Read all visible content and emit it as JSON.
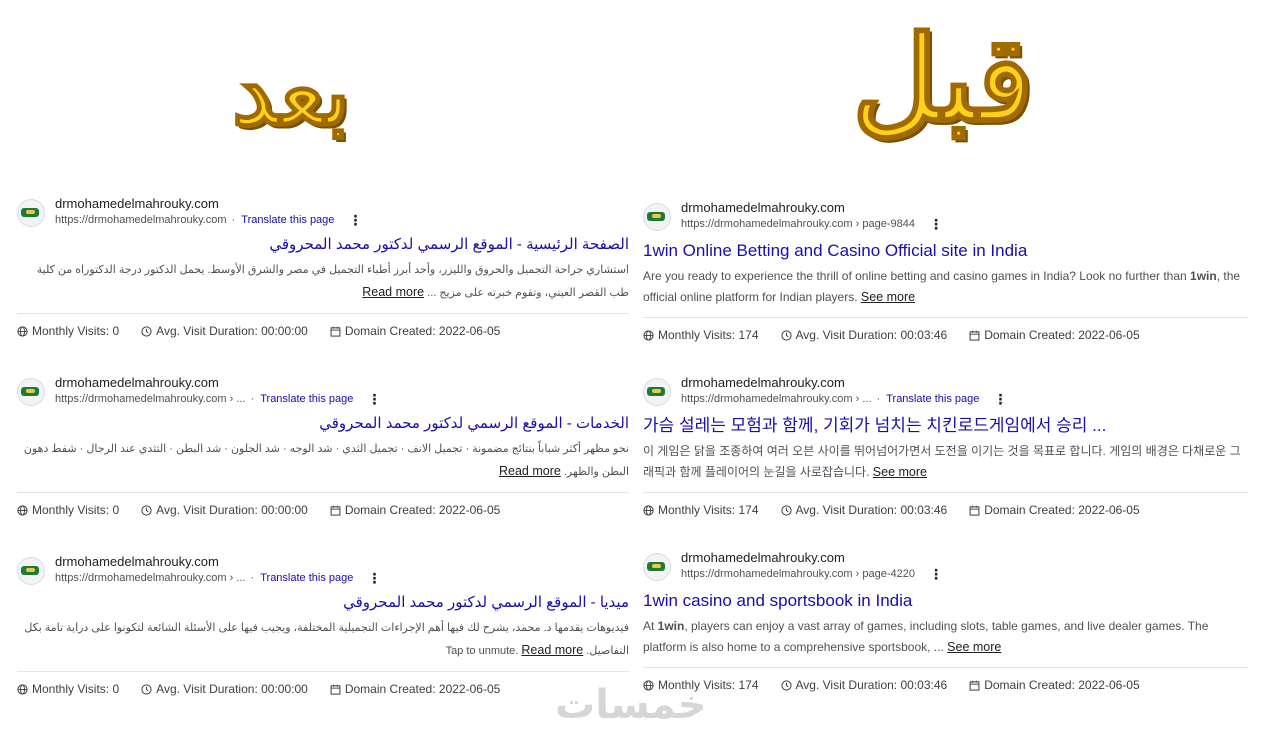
{
  "headings": {
    "after": "بعد",
    "before": "قبل"
  },
  "stat_labels": {
    "visits": "Monthly Visits:",
    "duration": "Avg. Visit Duration:",
    "created": "Domain Created:"
  },
  "more_labels": {
    "read": "Read more",
    "see": "See more"
  },
  "left_results": [
    {
      "site": "drmohamedelmahrouky.com",
      "url": "https://drmohamedelmahrouky.com",
      "translate": "Translate this page",
      "title": "الصفحة الرئيسية - الموقع الرسمي لدكتور محمد المحروقي",
      "snippet": "استشاري جراحة التجميل والحروق والليزر، وأحد أبرز أطباء التجميل في مصر والشرق الأوسط. يحمل الدكتور درجة الدكتوراه من كلية طب القصر العيني، وتقوم خبرته على مزيج ...",
      "visits": "0",
      "duration": "00:00:00",
      "created": "2022-06-05"
    },
    {
      "site": "drmohamedelmahrouky.com",
      "url": "https://drmohamedelmahrouky.com › ...",
      "translate": "Translate this page",
      "title": "الخدمات - الموقع الرسمي لدكتور محمد المحروقي",
      "snippet": "نحو مظهر أكثر شباباً بنتائج مضمونة · تجميل الانف · تجميل الثدي · شد الوجه · شد الجلون · شد البطن · التثدي عند الرجال · شفط دهون البطن والظهر.",
      "visits": "0",
      "duration": "00:00:00",
      "created": "2022-06-05"
    },
    {
      "site": "drmohamedelmahrouky.com",
      "url": "https://drmohamedelmahrouky.com › ...",
      "translate": "Translate this page",
      "title": "ميديا - الموقع الرسمي لدكتور محمد المحروقي",
      "snippet": "فيديوهات يقدمها د. محمد، يشرح لك فيها أهم الإجراءات التجميلية المختلفة، ويجيب فيها على الأسئلة الشائعة لتكونوا على دراية تامة بكل التفاصيل. Tap to unmute.",
      "visits": "0",
      "duration": "00:00:00",
      "created": "2022-06-05"
    }
  ],
  "right_results": [
    {
      "site": "drmohamedelmahrouky.com",
      "url": "https://drmohamedelmahrouky.com › page-9844",
      "translate": "",
      "title": "1win Online Betting and Casino Official site in India",
      "snippet_pre": "Are you ready to experience the thrill of online betting and casino games in India? Look no further than ",
      "snippet_bold": "1win",
      "snippet_post": ", the official online platform for Indian players.",
      "visits": "174",
      "duration": "00:03:46",
      "created": "2022-06-05"
    },
    {
      "site": "drmohamedelmahrouky.com",
      "url": "https://drmohamedelmahrouky.com › ...",
      "translate": "Translate this page",
      "title": "가슴 설레는 모험과 함께, 기회가 넘치는 치킨로드게임에서 승리 ...",
      "snippet_pre": "이 게임은 닭을 조종하여 여러 오븐 사이를 뛰어넘어가면서 도전을 이기는 것을 목표로 합니다. 게임의 배경은 다채로운 그래픽과 함께 플레이어의 눈길을 사로잡습니다.",
      "snippet_bold": "",
      "snippet_post": "",
      "visits": "174",
      "duration": "00:03:46",
      "created": "2022-06-05"
    },
    {
      "site": "drmohamedelmahrouky.com",
      "url": "https://drmohamedelmahrouky.com › page-4220",
      "translate": "",
      "title": "1win casino and sportsbook in India",
      "snippet_pre": "At ",
      "snippet_bold": "1win",
      "snippet_post": ", players can enjoy a vast array of games, including slots, table games, and live dealer games. The platform is also home to a comprehensive sportsbook, ...",
      "visits": "174",
      "duration": "00:03:46",
      "created": "2022-06-05"
    }
  ],
  "watermark": "خمسات"
}
